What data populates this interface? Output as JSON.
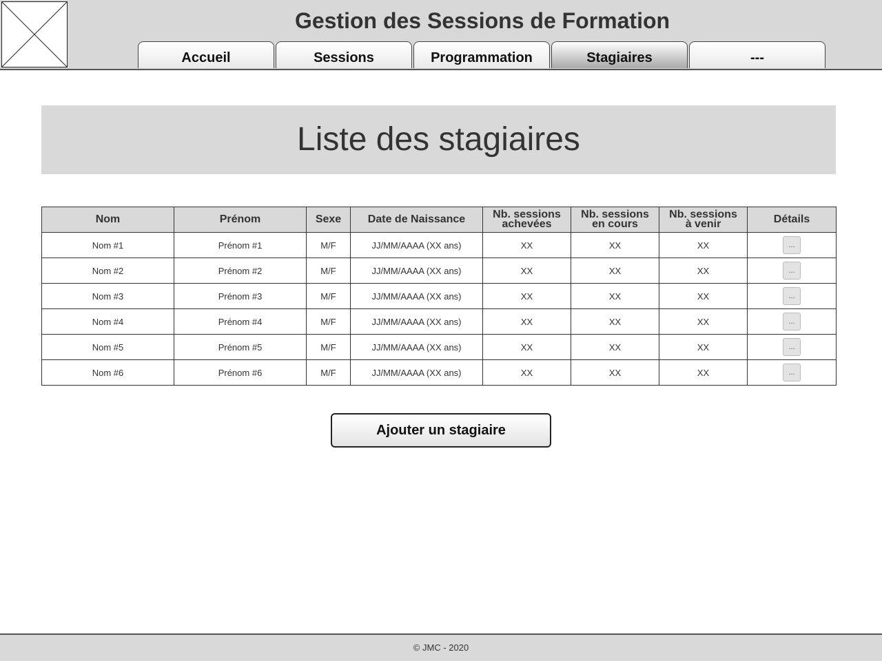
{
  "header": {
    "title": "Gestion des Sessions de Formation",
    "logo_icon": "image-placeholder-icon"
  },
  "nav": {
    "tabs": [
      {
        "label": "Accueil",
        "active": false
      },
      {
        "label": "Sessions",
        "active": false
      },
      {
        "label": "Programmation",
        "active": false
      },
      {
        "label": "Stagiaires",
        "active": true
      },
      {
        "label": "---",
        "active": false
      }
    ]
  },
  "main": {
    "page_title": "Liste des stagiaires",
    "table": {
      "columns": [
        {
          "label": "Nom"
        },
        {
          "label": "Prénom"
        },
        {
          "label": "Sexe"
        },
        {
          "label": "Date de Naissance"
        },
        {
          "label": "Nb. sessions achevées",
          "line1": "Nb. sessions",
          "line2": "achevées"
        },
        {
          "label": "Nb. sessions en cours",
          "line1": "Nb. sessions",
          "line2": "en cours"
        },
        {
          "label": "Nb. sessions à venir",
          "line1": "Nb. sessions",
          "line2": "à venir"
        },
        {
          "label": "Détails"
        }
      ],
      "rows": [
        {
          "nom": "Nom #1",
          "prenom": "Prénom #1",
          "sexe": "M/F",
          "naissance": "JJ/MM/AAAA (XX ans)",
          "achevees": "XX",
          "en_cours": "XX",
          "a_venir": "XX",
          "details": "..."
        },
        {
          "nom": "Nom #2",
          "prenom": "Prénom #2",
          "sexe": "M/F",
          "naissance": "JJ/MM/AAAA (XX ans)",
          "achevees": "XX",
          "en_cours": "XX",
          "a_venir": "XX",
          "details": "..."
        },
        {
          "nom": "Nom #3",
          "prenom": "Prénom #3",
          "sexe": "M/F",
          "naissance": "JJ/MM/AAAA (XX ans)",
          "achevees": "XX",
          "en_cours": "XX",
          "a_venir": "XX",
          "details": "..."
        },
        {
          "nom": "Nom #4",
          "prenom": "Prénom #4",
          "sexe": "M/F",
          "naissance": "JJ/MM/AAAA (XX ans)",
          "achevees": "XX",
          "en_cours": "XX",
          "a_venir": "XX",
          "details": "..."
        },
        {
          "nom": "Nom #5",
          "prenom": "Prénom #5",
          "sexe": "M/F",
          "naissance": "JJ/MM/AAAA (XX ans)",
          "achevees": "XX",
          "en_cours": "XX",
          "a_venir": "XX",
          "details": "..."
        },
        {
          "nom": "Nom #6",
          "prenom": "Prénom #6",
          "sexe": "M/F",
          "naissance": "JJ/MM/AAAA (XX ans)",
          "achevees": "XX",
          "en_cours": "XX",
          "a_venir": "XX",
          "details": "..."
        }
      ]
    },
    "add_button_label": "Ajouter un stagiaire"
  },
  "footer": {
    "text": "© JMC - 2020"
  },
  "colors": {
    "chrome_gray": "#d8d8d8",
    "active_tab_gradient_end": "#a9a9a9",
    "border": "#333333"
  }
}
